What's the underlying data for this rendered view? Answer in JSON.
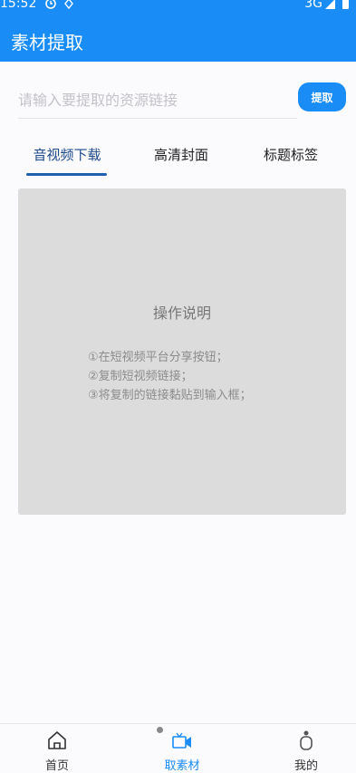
{
  "status_bar": {
    "time": "15:52",
    "network": "3G"
  },
  "header": {
    "title": "素材提取"
  },
  "search": {
    "placeholder": "请输入要提取的资源链接",
    "value": "",
    "button_label": "提取"
  },
  "tabs": [
    {
      "label": "音视频下载",
      "active": true
    },
    {
      "label": "高清封面",
      "active": false
    },
    {
      "label": "标题标签",
      "active": false
    }
  ],
  "panel": {
    "title": "操作说明",
    "steps": [
      "①在短视频平台分享按钮；",
      "②复制短视频链接；",
      "③将复制的链接黏贴到输入框；"
    ]
  },
  "bottom_nav": [
    {
      "label": "首页",
      "icon": "home-icon",
      "active": false
    },
    {
      "label": "取素材",
      "icon": "camera-icon",
      "active": true
    },
    {
      "label": "我的",
      "icon": "user-icon",
      "active": false
    }
  ],
  "colors": {
    "primary": "#1a8cf6",
    "tab_active": "#1e4a8a",
    "panel_bg": "#dcdcdc"
  }
}
